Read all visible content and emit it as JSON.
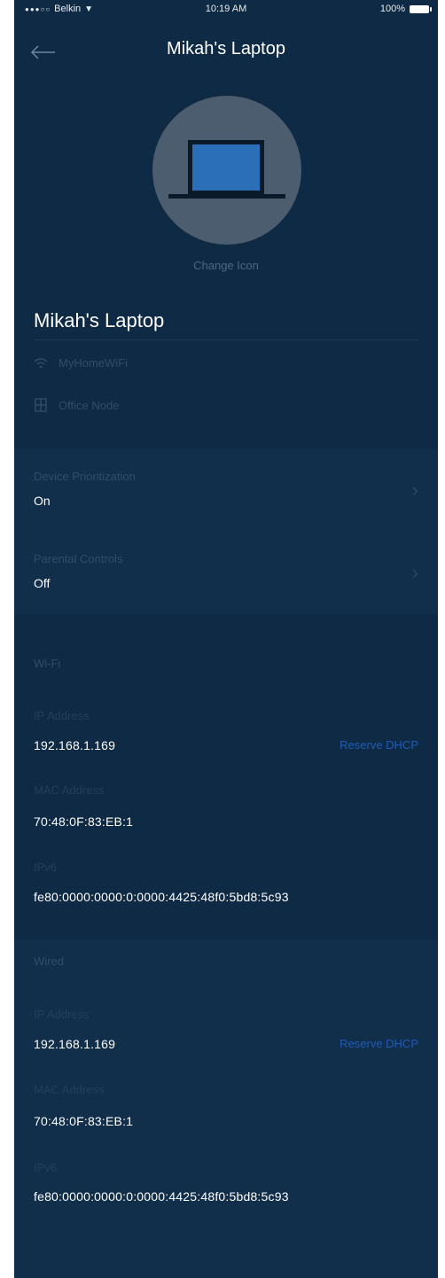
{
  "status_bar": {
    "carrier": "Belkin",
    "time": "10:19 AM",
    "battery": "100%"
  },
  "header": {
    "title": "Mikah's Laptop",
    "back_icon": "arrow-left-icon"
  },
  "device": {
    "icon": "laptop-icon",
    "change_icon_label": "Change Icon",
    "name": "Mikah's Laptop",
    "network": "MyHomeWiFi",
    "node": "Office Node"
  },
  "settings": [
    {
      "label": "Device Prioritization",
      "value": "On"
    },
    {
      "label": "Parental Controls",
      "value": "Off"
    }
  ],
  "wifi": {
    "section_label": "Wi-Fi",
    "ip_label": "IP Address",
    "ip_value": "192.168.1.169",
    "reserve_label": "Reserve DHCP",
    "mac_label": "MAC Address",
    "mac_value": "70:48:0F:83:EB:1",
    "ipv6_label": "IPv6",
    "ipv6_value": "fe80:0000:0000:0:0000:4425:48f0:5bd8:5c93"
  },
  "wired": {
    "section_label": "Wired",
    "ip_label": "IP Address",
    "ip_value": "192.168.1.169",
    "reserve_label": "Reserve DHCP",
    "mac_label": "MAC Address",
    "mac_value": "70:48:0F:83:EB:1",
    "ipv6_label": "IPv6",
    "ipv6_value": "fe80:0000:0000:0:0000:4425:48f0:5bd8:5c93"
  },
  "colors": {
    "background": "#0f2a44",
    "accent_link": "#1f5cb8",
    "icon_circle": "#4b5d6f",
    "laptop_screen": "#2a6fb8"
  }
}
